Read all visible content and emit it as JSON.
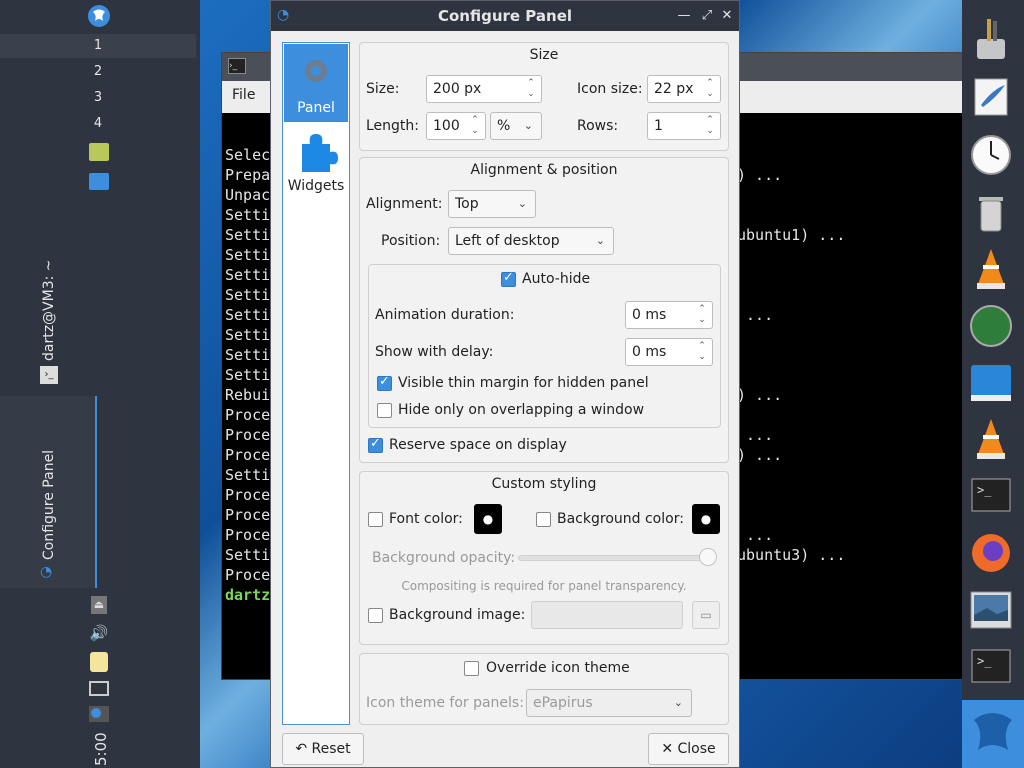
{
  "left_panel": {
    "desktops": [
      "1",
      "2",
      "3",
      "4"
    ],
    "tasks": [
      {
        "label": "dartz@VM3: ~"
      },
      {
        "label": "Configure Panel"
      }
    ],
    "clock": "5:00"
  },
  "terminal": {
    "menu": [
      "File"
    ],
    "lines_left": [
      "Selec",
      "Prepa",
      "Unpac",
      "Setti",
      "Setti",
      "Setti",
      "Setti",
      "Setti",
      "Setti",
      "Setti",
      "Setti",
      "Setti",
      "Rebui",
      "Proce",
      "Proce",
      "Proce",
      "Setti",
      "Proce",
      "Proce",
      "Proce",
      "Setti",
      "Proce",
      "dartz"
    ],
    "lines_right": [
      {
        "text": ") ...",
        "row": 1
      },
      {
        "text": "ubuntu1) ...",
        "row": 4
      },
      {
        "text": " ...",
        "row": 8
      },
      {
        "text": ") ...",
        "row": 12
      },
      {
        "text": " ...",
        "row": 14
      },
      {
        "text": ") ...",
        "row": 15
      },
      {
        "text": " ...",
        "row": 19
      },
      {
        "text": "ubuntu3) ...",
        "row": 20
      }
    ]
  },
  "dialog": {
    "title": "Configure Panel",
    "sidebar": [
      {
        "label": "Panel"
      },
      {
        "label": "Widgets"
      }
    ],
    "size_group": {
      "title": "Size",
      "size_label": "Size:",
      "size_value": "200 px",
      "icon_size_label": "Icon size:",
      "icon_size_value": "22 px",
      "length_label": "Length:",
      "length_value": "100",
      "length_unit": "%",
      "rows_label": "Rows:",
      "rows_value": "1"
    },
    "alignment_group": {
      "title": "Alignment & position",
      "alignment_label": "Alignment:",
      "alignment_value": "Top",
      "position_label": "Position:",
      "position_value": "Left of desktop",
      "autohide_label": "Auto-hide",
      "autohide_checked": true,
      "anim_label": "Animation duration:",
      "anim_value": "0 ms",
      "delay_label": "Show with delay:",
      "delay_value": "0 ms",
      "thin_margin_label": "Visible thin margin for hidden panel",
      "thin_margin_checked": true,
      "overlap_label": "Hide only on overlapping a window",
      "overlap_checked": false,
      "reserve_label": "Reserve space on display",
      "reserve_checked": true
    },
    "styling_group": {
      "title": "Custom styling",
      "font_color_label": "Font color:",
      "bg_color_label": "Background color:",
      "opacity_label": "Background opacity:",
      "opacity_value": 1.0,
      "compositing_note": "Compositing is required for panel transparency.",
      "bg_image_label": "Background image:"
    },
    "icon_group": {
      "override_label": "Override icon theme",
      "theme_label": "Icon theme for panels:",
      "theme_value": "ePapirus"
    },
    "buttons": {
      "reset": "Reset",
      "close": "Close"
    }
  }
}
